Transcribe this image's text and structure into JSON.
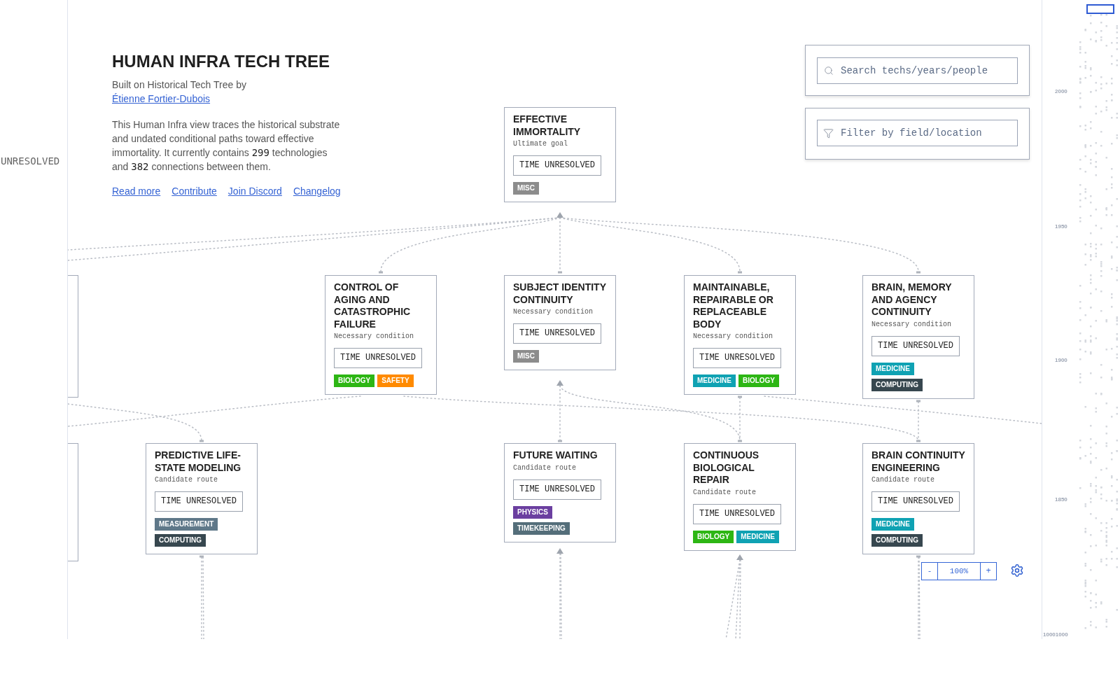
{
  "axis_label": "UNRESOLVED",
  "header": {
    "title": "HUMAN INFRA TECH TREE",
    "credit": {
      "text": "Built on Historical Tech Tree by",
      "link": "Étienne Fortier-Dubois"
    },
    "description": [
      {
        "kind": "text",
        "text": "This Human Infra view traces the historical substrate and undated conditional paths toward effective immortality. It currently contains "
      },
      {
        "kind": "count",
        "text": "299"
      },
      {
        "kind": "text",
        "text": " technologies and "
      },
      {
        "kind": "count",
        "text": "382"
      },
      {
        "kind": "text",
        "text": " connections between them."
      }
    ],
    "links": [
      "Read more",
      "Contribute",
      "Join Discord",
      "Changelog"
    ]
  },
  "search": {
    "placeholder": "Search techs/years/people"
  },
  "filter": {
    "placeholder": "Filter by field/location"
  },
  "nodes": [
    {
      "title": "EFFECTIVE IMMORTALITY",
      "subtitle": "Ultimate goal",
      "time": "TIME UNRESOLVED",
      "tags": [
        {
          "label": "MISC",
          "color": "#8c8c8c"
        }
      ]
    },
    {
      "title": "CONTROL OF AGING AND CATASTROPHIC FAILURE",
      "subtitle": "Necessary condition",
      "time": "TIME UNRESOLVED",
      "tags": [
        {
          "label": "BIOLOGY",
          "color": "#2db614"
        },
        {
          "label": "SAFETY",
          "color": "#ff8a00"
        }
      ]
    },
    {
      "title": "SUBJECT IDENTITY CONTINUITY",
      "subtitle": "Necessary condition",
      "time": "TIME UNRESOLVED",
      "tags": [
        {
          "label": "MISC",
          "color": "#8c8c8c"
        }
      ]
    },
    {
      "title": "MAINTAINABLE, REPAIRABLE OR REPLACEABLE BODY",
      "subtitle": "Necessary condition",
      "time": "TIME UNRESOLVED",
      "tags": [
        {
          "label": "MEDICINE",
          "color": "#0fa2b3"
        },
        {
          "label": "BIOLOGY",
          "color": "#2db614"
        }
      ]
    },
    {
      "title": "BRAIN, MEMORY AND AGENCY CONTINUITY",
      "subtitle": "Necessary condition",
      "time": "TIME UNRESOLVED",
      "tags": [
        {
          "label": "MEDICINE",
          "color": "#0fa2b3"
        },
        {
          "label": "COMPUTING",
          "color": "#37474f"
        }
      ]
    },
    {
      "title": "PREDICTIVE LIFE-STATE MODELING",
      "subtitle": "Candidate route",
      "time": "TIME UNRESOLVED",
      "tags": [
        {
          "label": "MEASUREMENT",
          "color": "#5f7889"
        },
        {
          "label": "COMPUTING",
          "color": "#37474f"
        }
      ]
    },
    {
      "title": "FUTURE WAITING",
      "subtitle": "Candidate route",
      "time": "TIME UNRESOLVED",
      "tags": [
        {
          "label": "PHYSICS",
          "color": "#6b3fa0"
        },
        {
          "label": "TIMEKEEPING",
          "color": "#546e7a"
        }
      ]
    },
    {
      "title": "CONTINUOUS BIOLOGICAL REPAIR",
      "subtitle": "Candidate route",
      "time": "TIME UNRESOLVED",
      "tags": [
        {
          "label": "BIOLOGY",
          "color": "#2db614"
        },
        {
          "label": "MEDICINE",
          "color": "#0fa2b3"
        }
      ]
    },
    {
      "title": "BRAIN CONTINUITY ENGINEERING",
      "subtitle": "Candidate route",
      "time": "TIME UNRESOLVED",
      "tags": [
        {
          "label": "MEDICINE",
          "color": "#0fa2b3"
        },
        {
          "label": "COMPUTING",
          "color": "#37474f"
        }
      ]
    }
  ],
  "zoom_controls": {
    "zoom_out": "-",
    "value": "100%",
    "zoom_in": "+"
  },
  "minimap": {
    "year_labels": [
      "2000",
      "1950",
      "1900",
      "1850",
      "10001000"
    ]
  }
}
